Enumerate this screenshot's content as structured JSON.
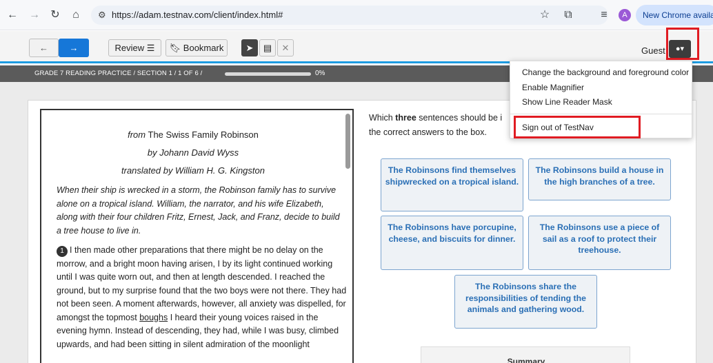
{
  "browser": {
    "url": "https://adam.testnav.com/client/index.html#",
    "profile_initial": "A",
    "update_label": "New Chrome available",
    "icons": [
      "back-arrow-icon",
      "forward-arrow-icon",
      "reload-icon",
      "home-icon",
      "site-settings-icon",
      "star-icon",
      "extensions-icon",
      "reading-list-icon"
    ]
  },
  "toolbar": {
    "back_label": "←",
    "forward_label": "→",
    "review_label": "Review ☰",
    "bookmark_label": "Bookmark",
    "guest_label": "Guest",
    "accent_color": "#1677d8"
  },
  "progress": {
    "breadcrumb": "GRADE 7 READING PRACTICE   /   SECTION 1   /   1 OF 6   /",
    "percent_label": "0%",
    "percent_value": 0
  },
  "passage": {
    "title_prefix": "from",
    "title": "The Swiss Family Robinson",
    "author": "by Johann David Wyss",
    "translator": "translated by William H. G. Kingston",
    "intro": "When their ship is wrecked in a storm, the Robinson family has to survive alone on a tropical island. William, the narrator, and his wife Elizabeth, along with their four children Fritz, Ernest, Jack, and Franz, decide to build a tree house to live in.",
    "para_number": "1",
    "para_text_1": "I then made other preparations that there might be no delay on the morrow, and a bright moon having arisen, I by its light continued working until I was quite worn out, and then at length descended. I reached the ground, but to my surprise found that the two boys were not there. They had not been seen. A moment afterwards, however, all anxiety was dispelled, for amongst the topmost ",
    "para_underlined": "boughs",
    "para_text_2": " I heard their young voices raised in the evening hymn. Instead of descending, they had, while I was busy, climbed upwards, and had been sitting in silent admiration of the moonlight"
  },
  "question": {
    "prefix": "Which ",
    "bold_word": "three",
    "rest": " sentences should be i",
    "line2": "the correct answers to the box."
  },
  "answers": [
    "The Robinsons find themselves shipwrecked on a tropical island.",
    "The Robinsons build a house in the high branches of a tree.",
    "The Robinsons have porcupine, cheese, and biscuits for dinner.",
    "The Robinsons use a piece of sail as a roof to protect their treehouse.",
    "The Robinsons share the responsibilities of tending the animals and gathering wood."
  ],
  "summary_label": "Summary",
  "menu": {
    "items": [
      "Change the background and foreground color",
      "Enable Magnifier",
      "Show Line Reader Mask",
      "Sign out of TestNav"
    ]
  },
  "highlight_color": "#e01b22"
}
